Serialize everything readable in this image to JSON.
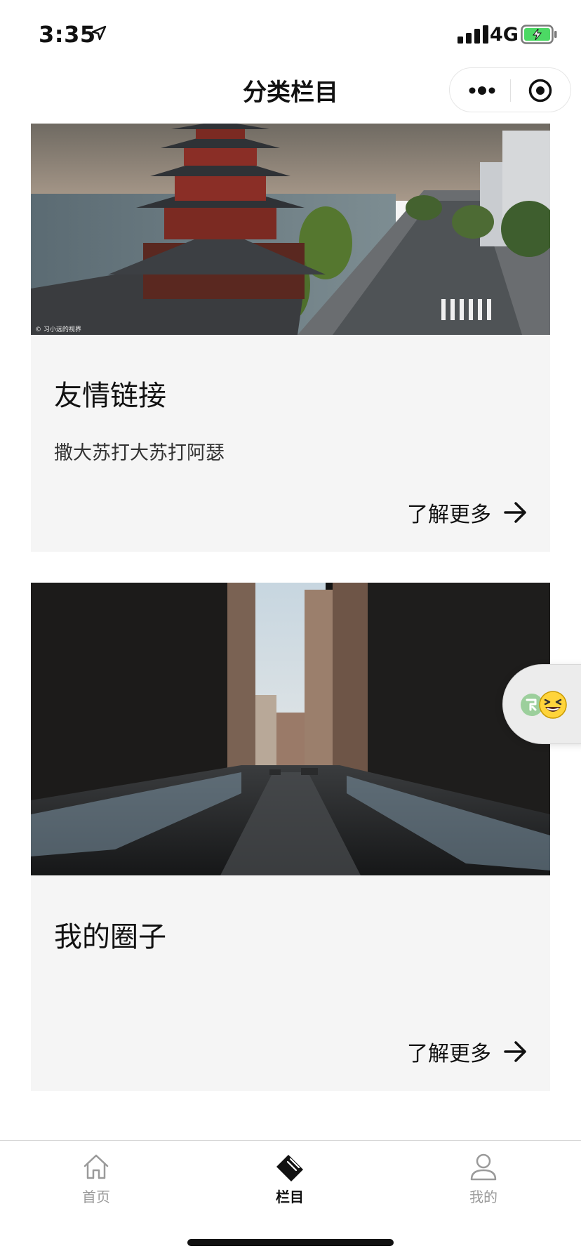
{
  "status_bar": {
    "time": "3:35",
    "network": "4G",
    "icons": [
      "location-arrow-icon",
      "signal-icon",
      "battery-charging-icon"
    ]
  },
  "nav": {
    "title": "分类栏目",
    "capsule_icons": [
      "more-dots-icon",
      "close-target-icon"
    ]
  },
  "cards": [
    {
      "image": "aerial-pagoda-riverside-photo",
      "watermark": "© 习小远的视界",
      "title": "友情链接",
      "description": "撒大苏打大苏打阿瑟",
      "more_label": "了解更多"
    },
    {
      "image": "city-street-snow-photo",
      "title": "我的圈子",
      "description": "",
      "more_label": "了解更多"
    }
  ],
  "float_bubble": {
    "icons": [
      "contact-app-icon",
      "laughing-emoji-icon"
    ]
  },
  "tab_bar": {
    "items": [
      {
        "label": "首页",
        "icon": "home-icon",
        "active": false
      },
      {
        "label": "栏目",
        "icon": "column-icon",
        "active": true
      },
      {
        "label": "我的",
        "icon": "user-icon",
        "active": false
      }
    ]
  },
  "colors": {
    "card_background": "#f5f5f5",
    "tab_active": "#111111",
    "tab_inactive": "#9a9a9a"
  }
}
